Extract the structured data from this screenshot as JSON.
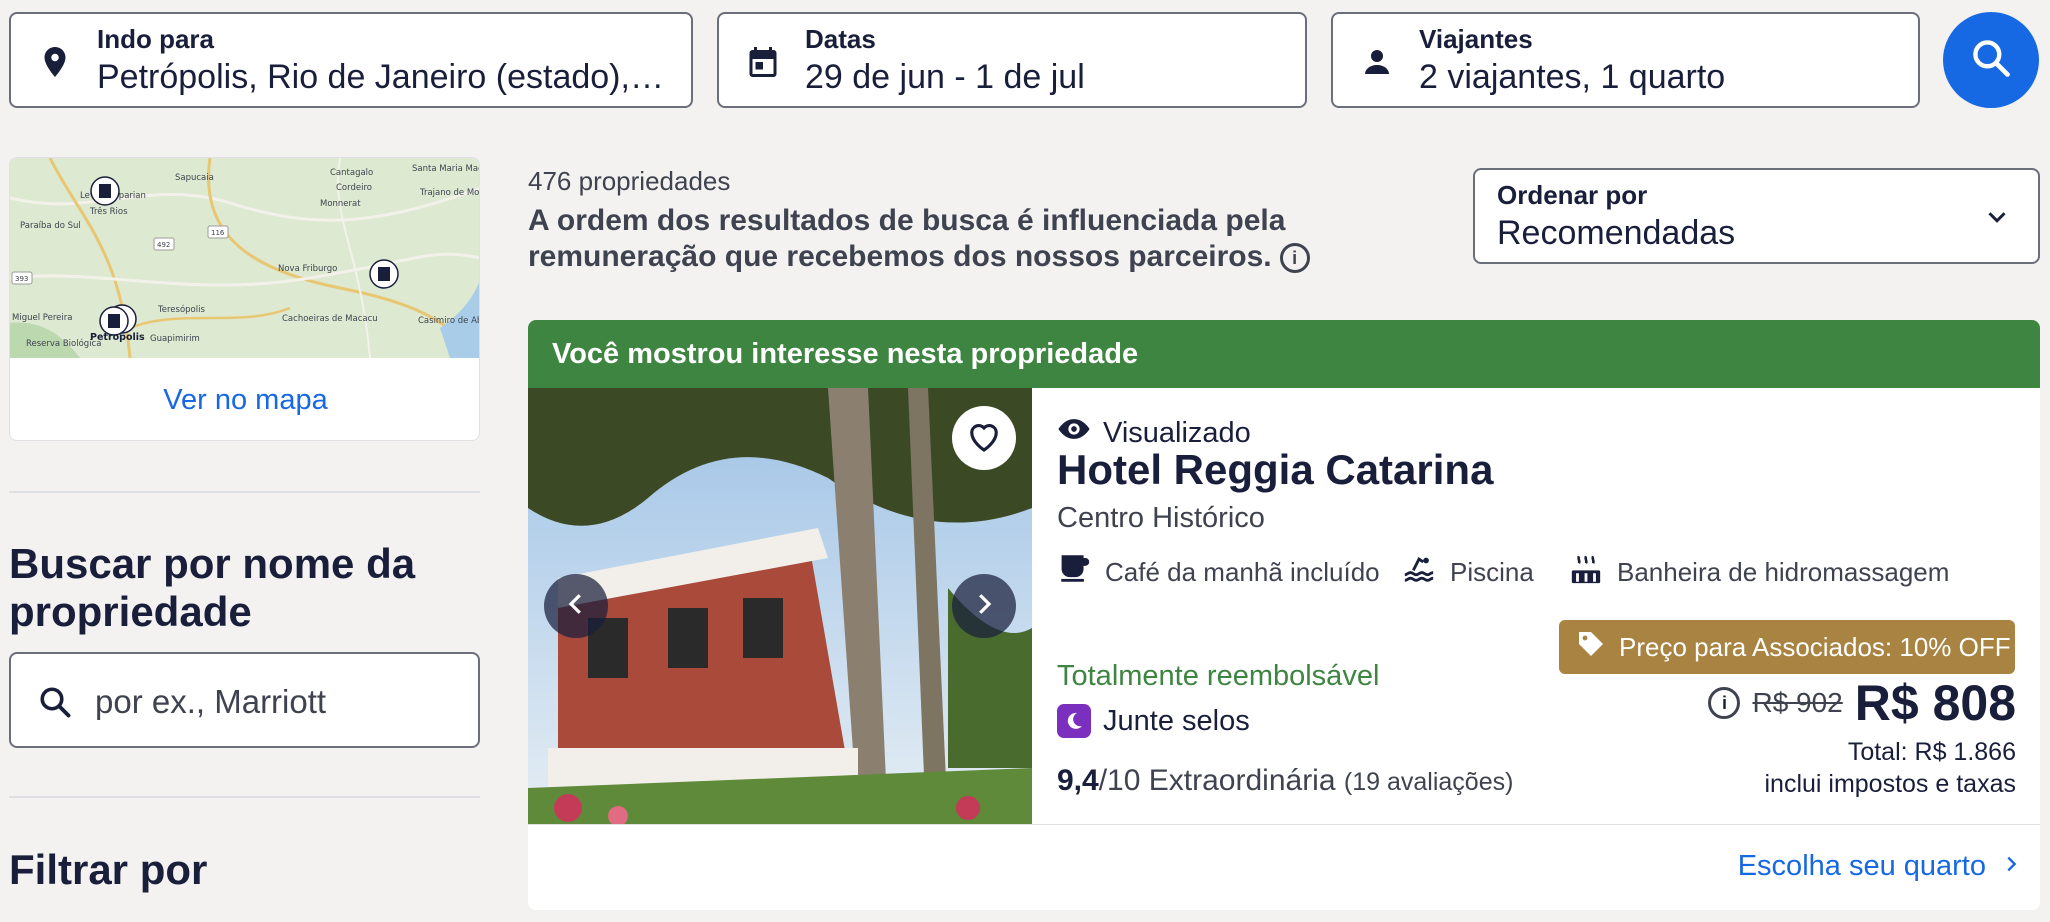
{
  "search": {
    "destination": {
      "label": "Indo para",
      "value": "Petrópolis, Rio de Janeiro (estado), B..."
    },
    "dates": {
      "label": "Datas",
      "value": "29 de jun - 1 de jul"
    },
    "travelers": {
      "label": "Viajantes",
      "value": "2 viajantes, 1 quarto"
    }
  },
  "map": {
    "link": "Ver no mapa",
    "places": [
      "Sapucaia",
      "Cantagalo",
      "Santa Maria Madalena",
      "Cordeiro",
      "Trajano de Morais",
      "Monnerat",
      "Levy Gasparian",
      "Três Rios",
      "Paraíba do Sul",
      "Nova Friburgo",
      "Teresópolis",
      "Cachoeiras de Macacu",
      "Casimiro de Abreu",
      "Petrópolis",
      "Guapimirim",
      "Miguel Pereira",
      "Reserva Biológica"
    ],
    "roads": [
      "492",
      "116",
      "393"
    ]
  },
  "sidebar": {
    "name_search_title": "Buscar por nome da propriedade",
    "name_search_placeholder": "por ex., Marriott",
    "filter_title": "Filtrar por"
  },
  "results": {
    "count": "476 propriedades",
    "notice": "A ordem dos resultados de busca é influenciada pela remuneração que recebemos dos nossos parceiros.",
    "sort": {
      "label": "Ordenar por",
      "value": "Recomendadas"
    }
  },
  "card": {
    "banner": "Você mostrou interesse nesta propriedade",
    "viewed": "Visualizado",
    "name": "Hotel Reggia Catarina",
    "district": "Centro Histórico",
    "amenities": [
      "Café da manhã incluído",
      "Piscina",
      "Banheira de hidromassagem"
    ],
    "refundable": "Totalmente reembolsável",
    "stamps": "Junte selos",
    "rating_score": "9,4",
    "rating_scale": "/10",
    "rating_label": "Extraordinária",
    "rating_count": "(19 avaliações)",
    "member_badge": "Preço para Associados: 10% OFF",
    "price_old": "R$ 902",
    "price_now": "R$ 808",
    "total": "Total: R$ 1.866",
    "taxes": "inclui impostos e taxas",
    "choose": "Escolha seu quarto"
  },
  "colors": {
    "accent": "#1668e3",
    "banner": "#3e8541",
    "member": "#a88341",
    "text": "#191e3b"
  },
  "icons": [
    "location-pin-icon",
    "calendar-icon",
    "person-icon",
    "search-icon",
    "chevron-down-icon",
    "info-icon",
    "heart-icon",
    "chevron-left-icon",
    "chevron-right-icon",
    "eye-icon",
    "coffee-icon",
    "pool-icon",
    "hot-tub-icon",
    "tag-icon",
    "moon-icon",
    "chevron-right-small-icon"
  ]
}
